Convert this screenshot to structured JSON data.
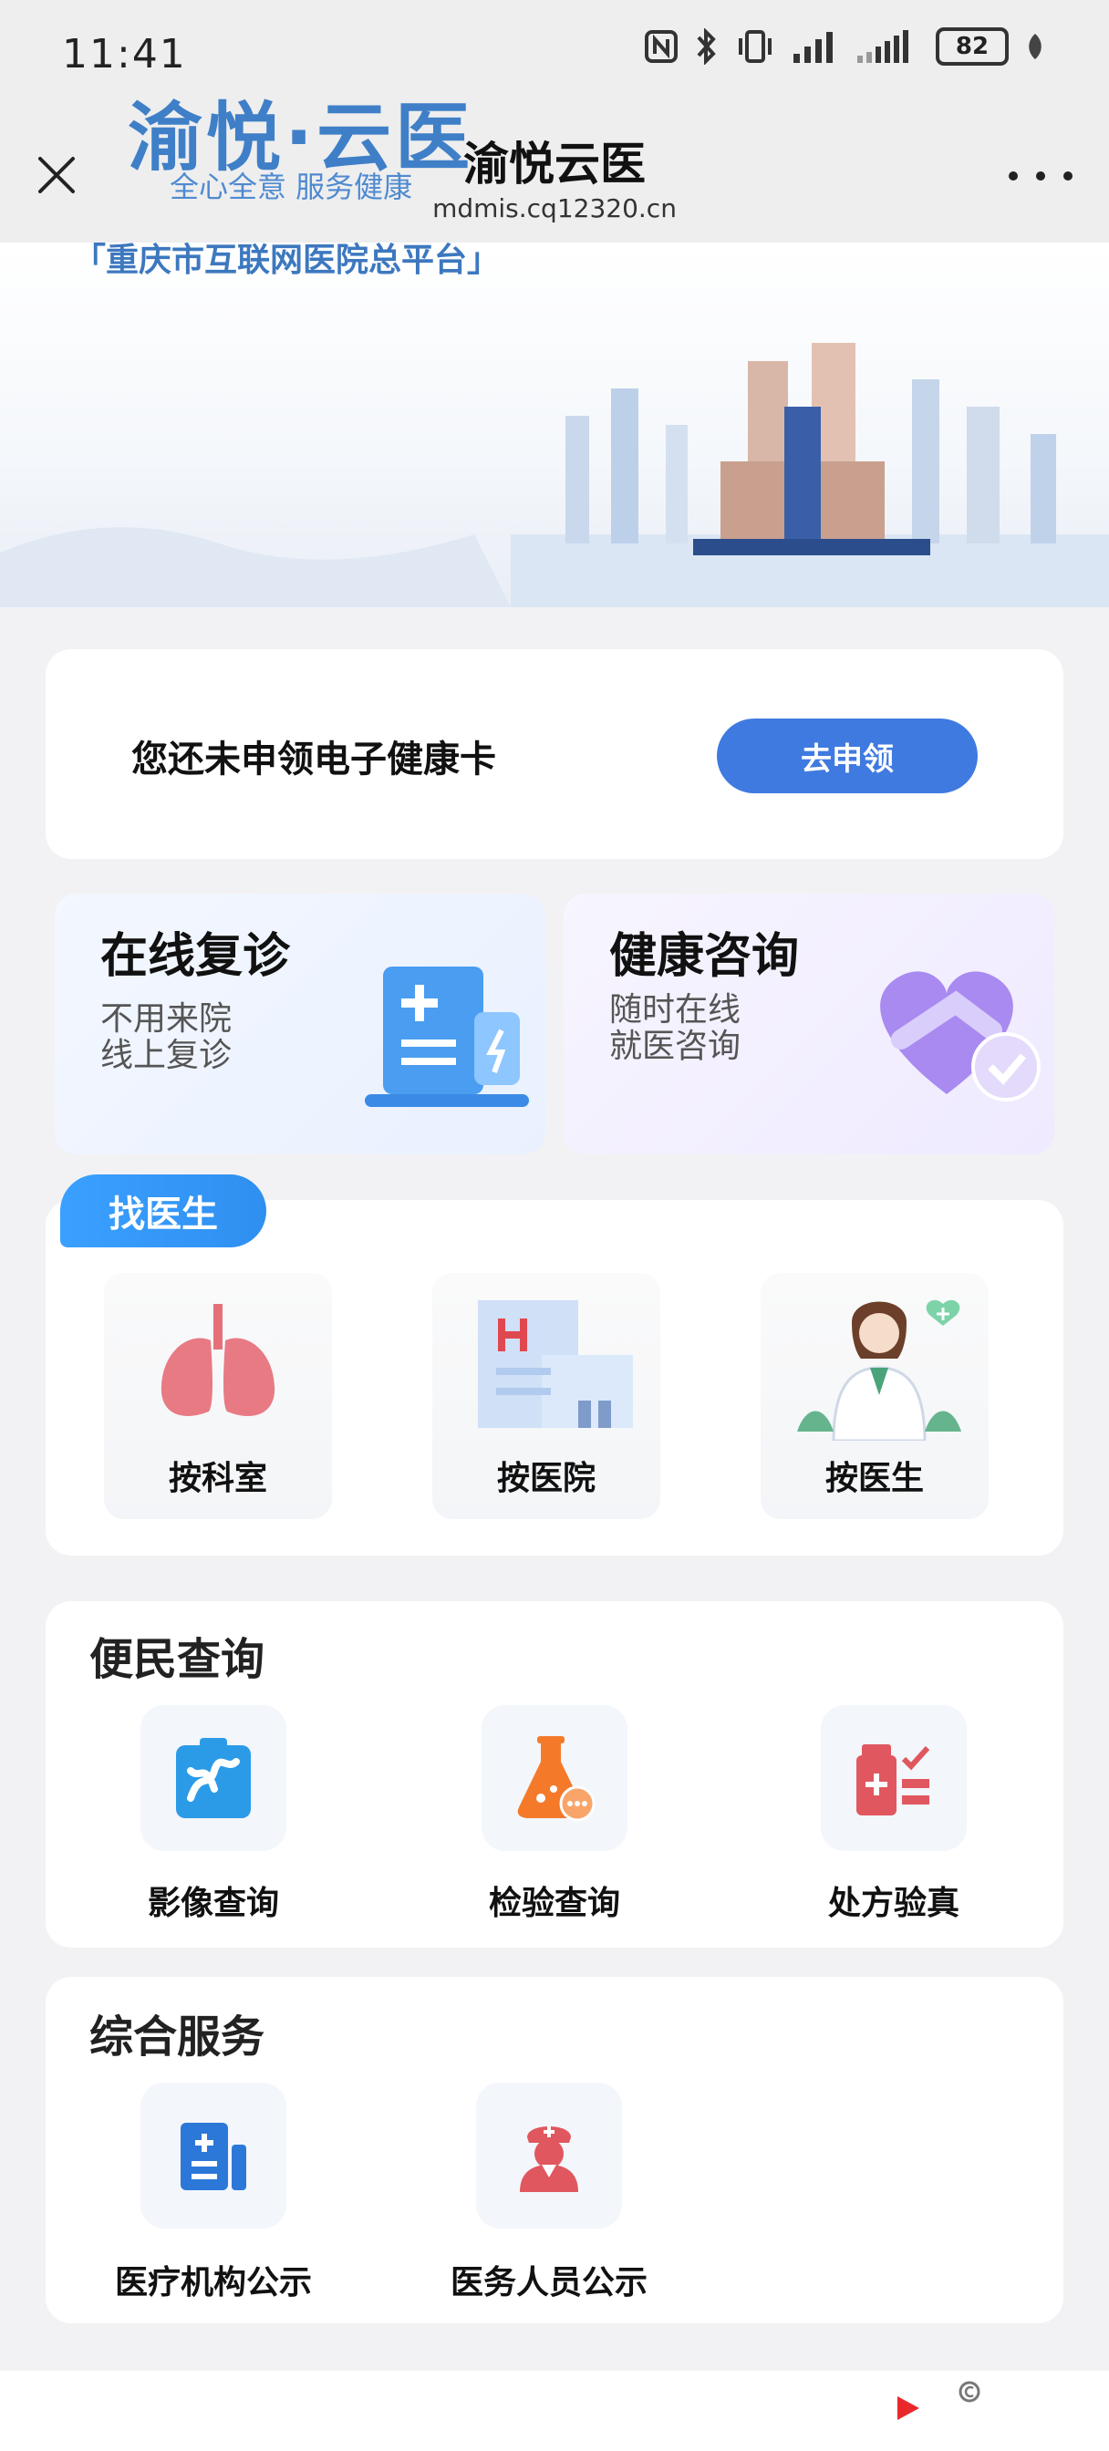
{
  "status_bar": {
    "time": "11:41",
    "battery": "82"
  },
  "nav": {
    "title": "渝悦云医",
    "url": "mdmis.cq12320.cn"
  },
  "banner": {
    "brand": "渝悦·云医",
    "slogan": "全心全意 服务健康",
    "platform": "「重庆市互联网医院总平台」"
  },
  "health_card": {
    "text": "您还未申领电子健康卡",
    "button": "去申领"
  },
  "features": [
    {
      "title": "在线复诊",
      "sub1": "不用来院",
      "sub2": "线上复诊"
    },
    {
      "title": "健康咨询",
      "sub1": "随时在线",
      "sub2": "就医咨询"
    }
  ],
  "find_doctor": {
    "tab": "找医生",
    "items": [
      {
        "label": "按科室"
      },
      {
        "label": "按医院"
      },
      {
        "label": "按医生"
      }
    ]
  },
  "convenience": {
    "title": "便民查询",
    "items": [
      {
        "label": "影像查询"
      },
      {
        "label": "检验查询"
      },
      {
        "label": "处方验真"
      }
    ]
  },
  "services": {
    "title": "综合服务",
    "items": [
      {
        "label": "医疗机构公示"
      },
      {
        "label": "医务人员公示"
      }
    ]
  },
  "colors": {
    "primary": "#3f7ae0",
    "tab_blue": "#2f8ff0",
    "brand_blue": "#3f7fc7"
  }
}
